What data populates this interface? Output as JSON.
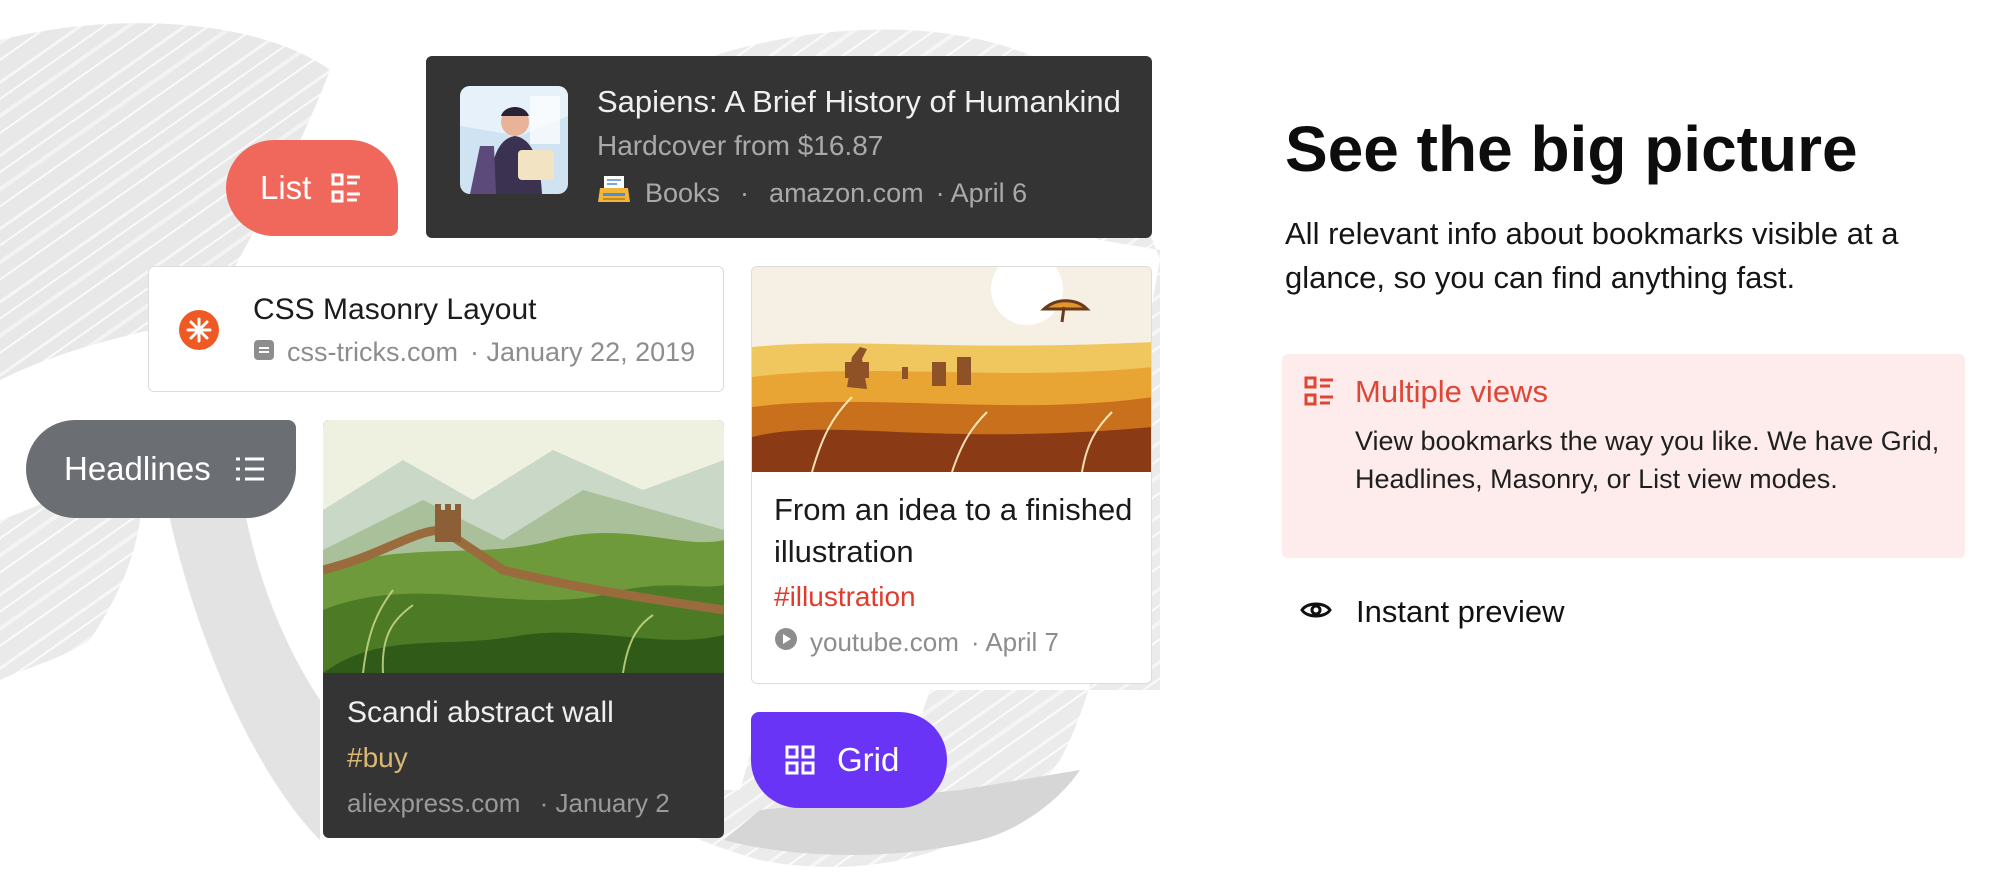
{
  "cards": {
    "sapiens": {
      "title": "Sapiens: A Brief History of Humankind",
      "subtitle": "Hardcover from $16.87",
      "category": "Books",
      "domain": "amazon.com",
      "date": "· April 6",
      "separator": "·"
    },
    "css_masonry": {
      "title": "CSS Masonry Layout",
      "domain": "css-tricks.com",
      "date": "· January 22, 2019"
    },
    "scandi": {
      "title": "Scandi abstract wall",
      "tag_hash": "#",
      "tag": "buy",
      "domain": "aliexpress.com",
      "date": "· January 2"
    },
    "illustration": {
      "title": "From an idea to a finished illustration",
      "tag_hash": "#",
      "tag": "illustration",
      "domain": "youtube.com",
      "date": "· April 7"
    }
  },
  "views": {
    "list": "List",
    "headlines": "Headlines",
    "grid": "Grid"
  },
  "panel": {
    "heading": "See the big picture",
    "lead": "All relevant info about bookmarks visible at a glance, so you can find anything fast.",
    "features": [
      {
        "title": "Multiple views",
        "description": "View bookmarks the way you like. We have Grid, Headlines, Masonry, or List view modes.",
        "active": true
      },
      {
        "title": "Instant preview",
        "active": false
      }
    ]
  },
  "colors": {
    "list_pill": "#f0675c",
    "headlines_pill": "#6b6f73",
    "grid_pill": "#6934f5",
    "accent_red": "#e04636",
    "feature_bg": "#fdeceb",
    "dark_card": "#343434"
  },
  "icons": [
    "list-view-icon",
    "headlines-icon",
    "grid-view-icon",
    "eye-icon",
    "css-tricks-icon",
    "youtube-icon",
    "typewriter-icon",
    "page-icon"
  ]
}
